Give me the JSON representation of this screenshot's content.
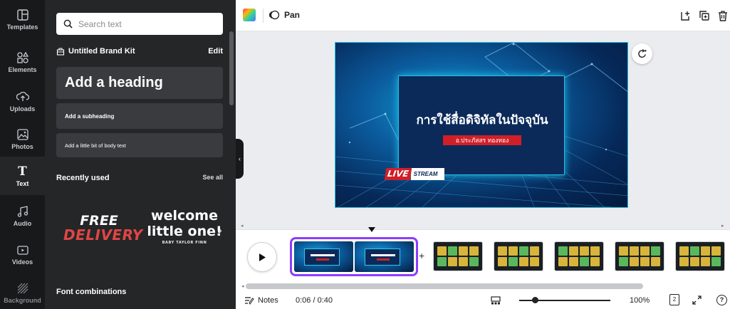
{
  "rail": {
    "items": [
      {
        "label": "Templates",
        "icon": "templates-icon"
      },
      {
        "label": "Elements",
        "icon": "elements-icon"
      },
      {
        "label": "Uploads",
        "icon": "upload-icon"
      },
      {
        "label": "Photos",
        "icon": "photo-icon"
      },
      {
        "label": "Text",
        "icon": "text-icon",
        "active": true
      },
      {
        "label": "Audio",
        "icon": "music-note-icon"
      },
      {
        "label": "Videos",
        "icon": "video-icon"
      },
      {
        "label": "Background",
        "icon": "background-icon"
      }
    ]
  },
  "panel": {
    "search_placeholder": "Search text",
    "brand_kit": "Untitled Brand Kit",
    "edit": "Edit",
    "heading": "Add a heading",
    "subheading": "Add a subheading",
    "body": "Add a little bit of body text",
    "recently_used": "Recently used",
    "see_all": "See all",
    "recent": {
      "free_line1": "FREE",
      "free_line2": "DELIVERY",
      "welcome_line1": "welcome",
      "welcome_line2": "little one!",
      "welcome_line3": "BABY TAYLOR FINN"
    },
    "font_combinations": "Font combinations"
  },
  "toolbar": {
    "pan_label": "Pan"
  },
  "slide": {
    "title": "การใช้สื่อดิจิทัลในปัจจุบัน",
    "subtitle": "อ.ประภัสสร ทองทอง",
    "live": "LIVE",
    "stream": "STREAM"
  },
  "bottom": {
    "notes": "Notes",
    "time": "0:06 / 0:40",
    "zoom": "100%",
    "page": "2",
    "help": "?"
  },
  "colors": {
    "accent": "#8b3dff",
    "panel_bg": "#252627",
    "rail_bg": "#18191b",
    "live_red": "#d01f28"
  }
}
